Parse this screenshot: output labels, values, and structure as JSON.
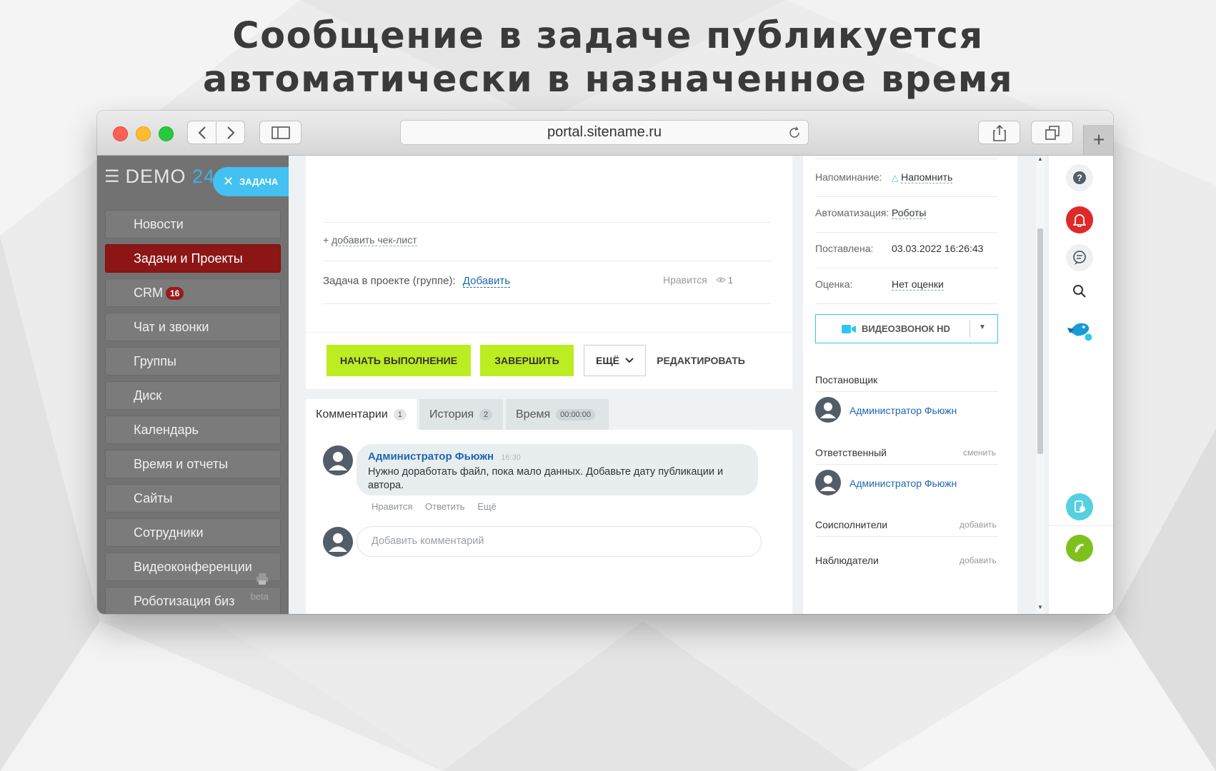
{
  "headline": {
    "line1": "Сообщение в задаче публикуется",
    "line2": "автоматически в назначенное время"
  },
  "browser": {
    "url": "portal.sitename.ru",
    "traffic_lights": [
      "#fe5f57",
      "#febc2e",
      "#28c840"
    ]
  },
  "sidebar": {
    "logo_text": "DEMO",
    "logo_num": "24",
    "task_button": "ЗАДАЧА",
    "items": [
      {
        "label": "Новости"
      },
      {
        "label": "Задачи и Проекты",
        "active": true
      },
      {
        "label": "CRM",
        "badge": "16"
      },
      {
        "label": "Чат и звонки"
      },
      {
        "label": "Группы"
      },
      {
        "label": "Диск"
      },
      {
        "label": "Календарь"
      },
      {
        "label": "Время и отчеты"
      },
      {
        "label": "Сайты"
      },
      {
        "label": "Сотрудники"
      },
      {
        "label": "Видеоконференции"
      },
      {
        "label": "Роботизация биз"
      }
    ],
    "beta_label": "beta"
  },
  "task": {
    "add_checklist": "добавить чек-лист",
    "project_label": "Задача в проекте (группе):",
    "project_add": "Добавить",
    "like": "Нравится",
    "views": "1",
    "buttons": {
      "start": "НАЧАТЬ ВЫПОЛНЕНИЕ",
      "finish": "ЗАВЕРШИТЬ",
      "more": "ЕЩЁ",
      "edit": "РЕДАКТИРОВАТЬ"
    }
  },
  "tabs": [
    {
      "label": "Комментарии",
      "count": "1",
      "active": true
    },
    {
      "label": "История",
      "count": "2"
    },
    {
      "label": "Время",
      "count": "00:00:00"
    }
  ],
  "comment": {
    "author": "Администратор Фьюжн",
    "time": "16:30",
    "text_line1": "Нужно доработать файл, пока мало  данных. Добавьте дату публикации и",
    "text_line2": "автора.",
    "actions": [
      "Нравится",
      "Ответить",
      "Ещё"
    ],
    "input_placeholder": "Добавить комментарий"
  },
  "right_panel": {
    "reminder_label": "Напоминание:",
    "reminder_value": "Напомнить",
    "automation_label": "Автоматизация:",
    "automation_value": "Роботы",
    "created_label": "Поставлена:",
    "created_value": "03.03.2022 16:26:43",
    "rating_label": "Оценка:",
    "rating_value": "Нет оценки",
    "video_call": "ВИДЕОЗВОНОК HD",
    "creator_title": "Постановщик",
    "creator_name": "Администратор Фьюжн",
    "responsible_title": "Ответственный",
    "responsible_change": "сменить",
    "responsible_name": "Администратор Фьюжн",
    "coexec_title": "Соисполнители",
    "coexec_add": "добавить",
    "observers_title": "Наблюдатели",
    "observers_add": "добавить"
  }
}
